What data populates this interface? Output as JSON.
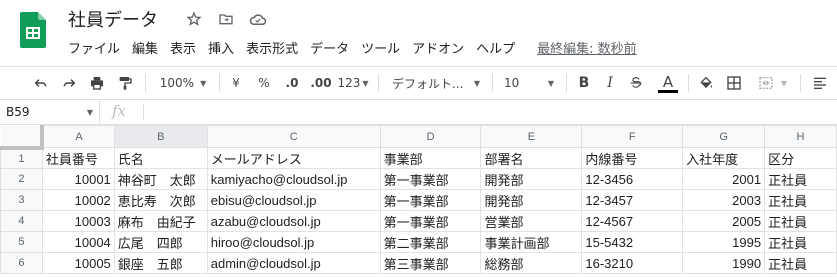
{
  "app": {
    "title": "社員データ",
    "brand_color": "#0f9d58"
  },
  "menu": {
    "items": [
      "ファイル",
      "編集",
      "表示",
      "挿入",
      "表示形式",
      "データ",
      "ツール",
      "アドオン",
      "ヘルプ"
    ],
    "last_edit": "最終編集: 数秒前"
  },
  "toolbar": {
    "zoom": "100%",
    "currency": "¥",
    "percent": "%",
    "dec_decrease": ".0",
    "dec_increase": ".00",
    "format_more": "123",
    "font": "デフォルト...",
    "font_size": "10",
    "bold": "B",
    "italic": "I",
    "text_color_label": "A"
  },
  "formula_bar": {
    "cell_ref": "B59",
    "fx_label": "fx"
  },
  "sheet": {
    "columns": [
      "A",
      "B",
      "C",
      "D",
      "E",
      "F",
      "G",
      "H"
    ],
    "row_numbers": [
      "1",
      "2",
      "3",
      "4",
      "5",
      "6"
    ],
    "rows": [
      [
        "社員番号",
        "氏名",
        "メールアドレス",
        "事業部",
        "部署名",
        "内線番号",
        "入社年度",
        "区分"
      ],
      [
        "10001",
        "神谷町　太郎",
        "kamiyacho@cloudsol.jp",
        "第一事業部",
        "開発部",
        "12-3456",
        "2001",
        "正社員"
      ],
      [
        "10002",
        "恵比寿　次郎",
        "ebisu@cloudsol.jp",
        "第一事業部",
        "開発部",
        "12-3457",
        "2003",
        "正社員"
      ],
      [
        "10003",
        "麻布　由紀子",
        "azabu@cloudsol.jp",
        "第一事業部",
        "営業部",
        "12-4567",
        "2005",
        "正社員"
      ],
      [
        "10004",
        "広尾　四郎",
        "hiroo@cloudsol.jp",
        "第二事業部",
        "事業計画部",
        "15-5432",
        "1995",
        "正社員"
      ],
      [
        "10005",
        "銀座　五郎",
        "admin@cloudsol.jp",
        "第三事業部",
        "総務部",
        "16-3210",
        "1990",
        "正社員"
      ]
    ]
  }
}
